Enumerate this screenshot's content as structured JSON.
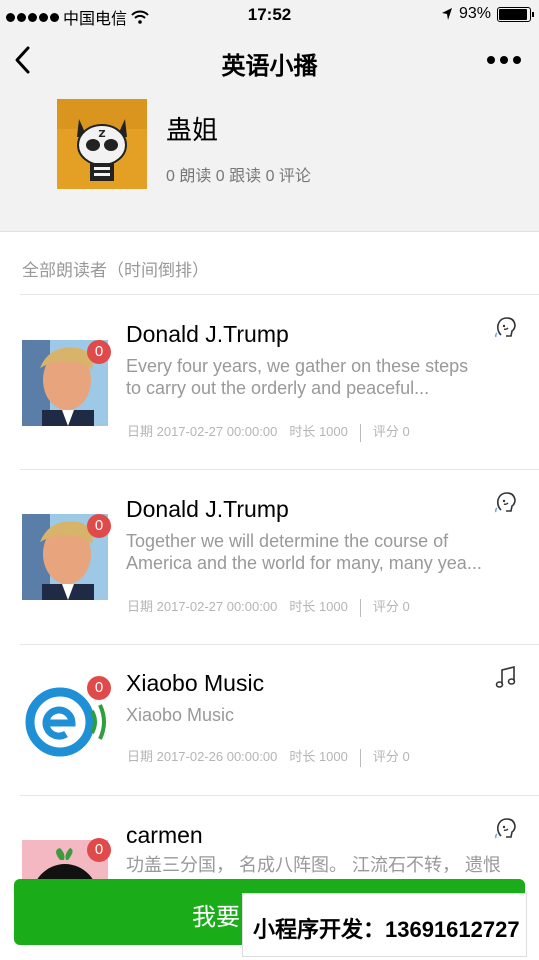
{
  "status_bar": {
    "carrier": "中国电信",
    "time": "17:52",
    "battery": "93%",
    "battery_level": 0.93
  },
  "nav": {
    "title": "英语小播"
  },
  "profile": {
    "name": "蛊姐",
    "stats": "0 朗读 0 跟读 0 评论"
  },
  "list": {
    "section_label": "全部朗读者（时间倒排）",
    "items": [
      {
        "badge": "0",
        "title": "Donald J.Trump",
        "desc_line1": "Every four years, we gather on these steps",
        "desc_line2": "to carry out the orderly and peaceful...",
        "date": "日期 2017-02-27 00:00:00",
        "duration": "时长 1000",
        "score": "评分 0",
        "icon": "speaking-head-icon",
        "avatar": "trump-photo"
      },
      {
        "badge": "0",
        "title": "Donald J.Trump",
        "desc_line1": "Together we will determine the course of",
        "desc_line2": "America and the world for many, many yea...",
        "date": "日期 2017-02-27 00:00:00",
        "duration": "时长 1000",
        "score": "评分 0",
        "icon": "speaking-head-icon",
        "avatar": "trump-photo"
      },
      {
        "badge": "0",
        "title": "Xiaobo Music",
        "desc_line1": "Xiaobo Music",
        "desc_line2": "",
        "date": "日期 2017-02-26 00:00:00",
        "duration": "时长 1000",
        "score": "评分 0",
        "icon": "music-note-icon",
        "avatar": "xiaobo-logo"
      },
      {
        "badge": "0",
        "title": "carmen",
        "desc_line1": "功盖三分国， 名成八阵图。 江流石不转， 遗恨",
        "desc_line2": "",
        "icon": "speaking-head-icon",
        "avatar": "carmen-avatar"
      }
    ]
  },
  "bottom_button": {
    "label": "我要"
  },
  "watermark": {
    "text": "小程序开发：13691612727"
  }
}
